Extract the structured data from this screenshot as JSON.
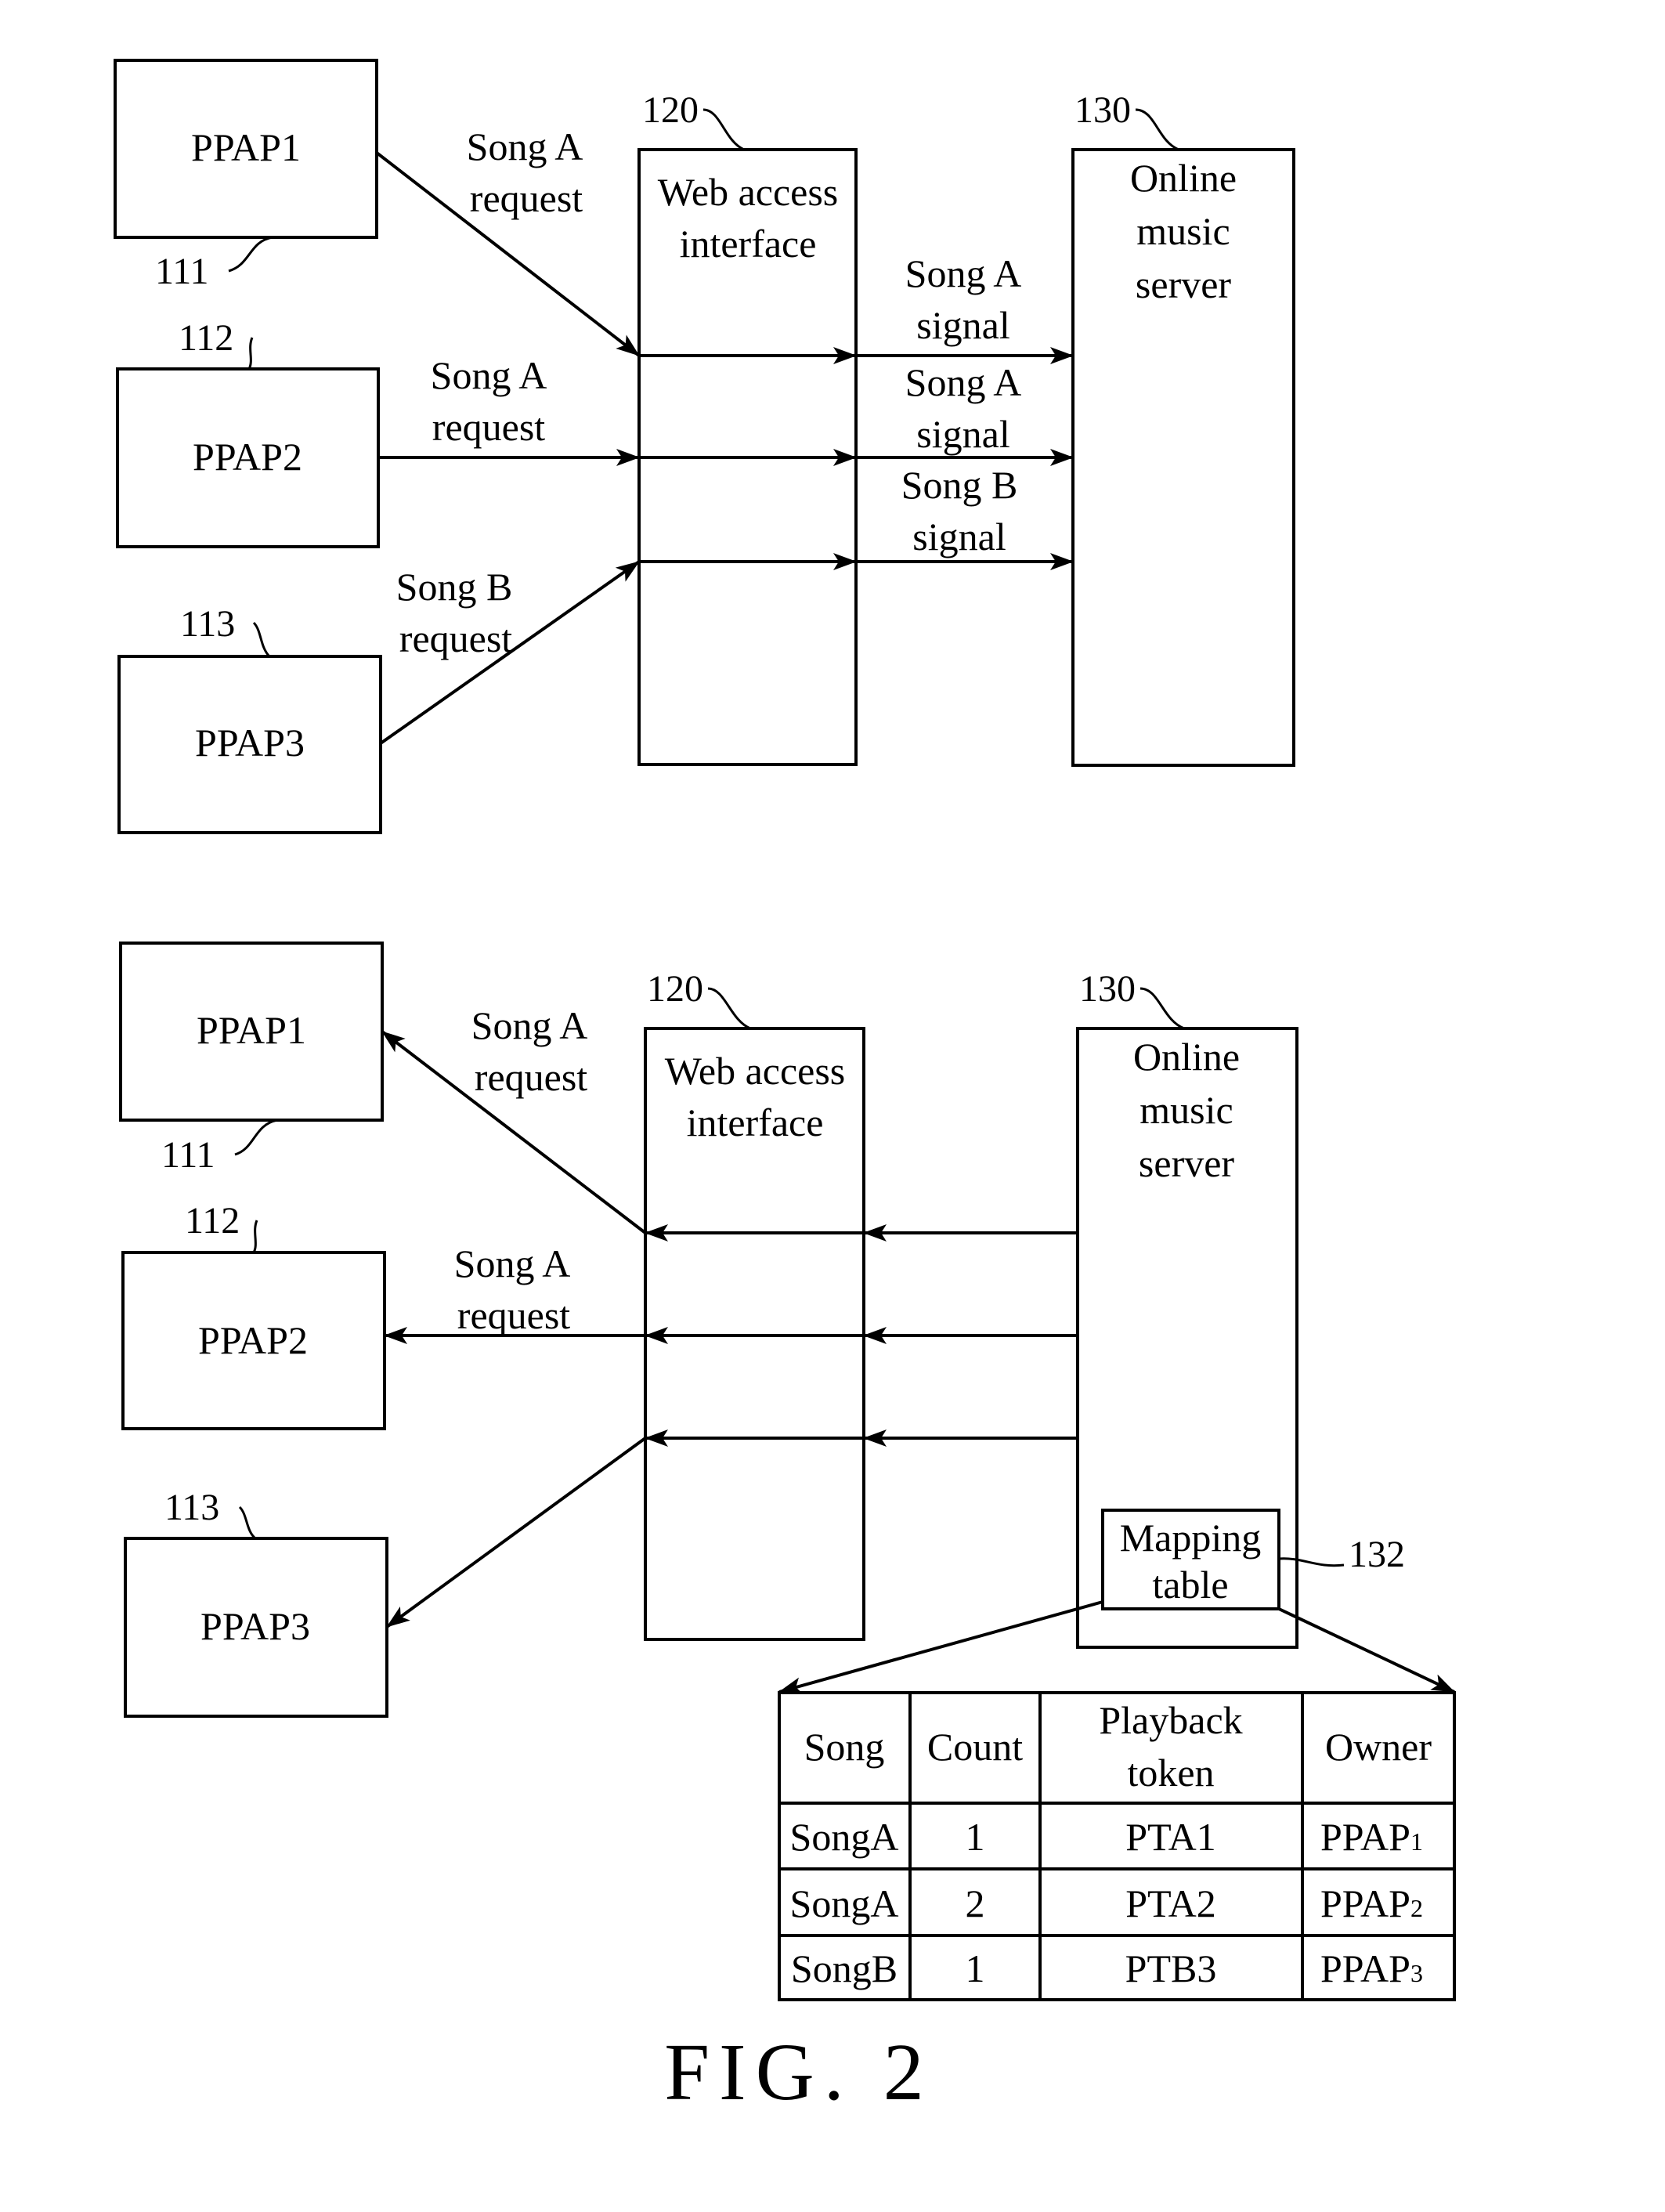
{
  "figure": {
    "caption": "FIG. 2"
  },
  "top_panel": {
    "clients": [
      {
        "label": "PPAP1",
        "ref": "111"
      },
      {
        "label": "PPAP2",
        "ref": "112"
      },
      {
        "label": "PPAP3",
        "ref": "113"
      }
    ],
    "web_interface": {
      "line1": "Web access",
      "line2": "interface",
      "ref": "120"
    },
    "server": {
      "line1": "Online",
      "line2": "music",
      "line3": "server",
      "ref": "130"
    },
    "request_labels": [
      {
        "line1": "Song A",
        "line2": "request"
      },
      {
        "line1": "Song A",
        "line2": "request"
      },
      {
        "line1": "Song B",
        "line2": "request"
      }
    ],
    "signal_labels": [
      {
        "line1": "Song A",
        "line2": "signal"
      },
      {
        "line1": "Song A",
        "line2": "signal"
      },
      {
        "line1": "Song B",
        "line2": "signal"
      }
    ]
  },
  "bottom_panel": {
    "clients": [
      {
        "label": "PPAP1",
        "ref": "111"
      },
      {
        "label": "PPAP2",
        "ref": "112"
      },
      {
        "label": "PPAP3",
        "ref": "113"
      }
    ],
    "web_interface": {
      "line1": "Web access",
      "line2": "interface",
      "ref": "120"
    },
    "server": {
      "line1": "Online",
      "line2": "music",
      "line3": "server",
      "ref": "130"
    },
    "response_labels": [
      {
        "line1": "Song A",
        "line2": "request"
      },
      {
        "line1": "Song A",
        "line2": "request"
      }
    ],
    "mapping_table_box": {
      "line1": "Mapping",
      "line2": "table",
      "ref": "132"
    },
    "mapping_table": {
      "headers": [
        {
          "line1": "Song",
          "line2": ""
        },
        {
          "line1": "Count",
          "line2": ""
        },
        {
          "line1": "Playback",
          "line2": "token"
        },
        {
          "line1": "Owner",
          "line2": ""
        }
      ],
      "rows": [
        {
          "song": "SongA",
          "count": "1",
          "token": "PTA1",
          "owner": "PPAP",
          "owner_sub": "1"
        },
        {
          "song": "SongA",
          "count": "2",
          "token": "PTA2",
          "owner": "PPAP",
          "owner_sub": "2"
        },
        {
          "song": "SongB",
          "count": "1",
          "token": "PTB3",
          "owner": "PPAP",
          "owner_sub": "3"
        }
      ]
    }
  }
}
